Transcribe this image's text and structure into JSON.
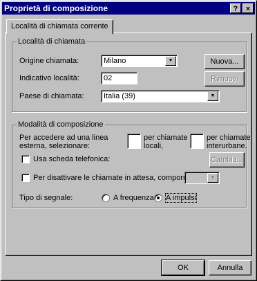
{
  "window": {
    "title": "Proprietà di composizione",
    "help_btn": "?",
    "close_btn": "×"
  },
  "tab": {
    "label": "Località di chiamata corrente"
  },
  "location_group": {
    "legend": "Località di chiamata",
    "origin_label": "Origine chiamata:",
    "origin_value": "Milano",
    "new_button": "Nuova...",
    "area_code_label": "Indicativo località:",
    "area_code_value": "02",
    "remove_button": "Rimuovi",
    "country_label": "Paese di chiamata:",
    "country_value": "Italia (39)"
  },
  "dialing_group": {
    "legend": "Modalità di composizione",
    "outside_line_label": "Per accedere ad una linea esterna, selezionare:",
    "local_label": "per chiamate locali,",
    "local_value": "",
    "long_distance_label": "per chiamate interurbane.",
    "long_distance_value": "",
    "calling_card_label": "Usa scheda telefonica:",
    "change_button": "Cambia...",
    "call_waiting_label": "Per disattivare le chiamate in attesa, comporre:",
    "call_waiting_value": "",
    "signal_type_label": "Tipo di segnale:",
    "tone_label": "A frequenza",
    "pulse_label": "A impulsi",
    "selected_signal": "pulse"
  },
  "footer": {
    "ok_button": "OK",
    "cancel_button": "Annulla"
  }
}
